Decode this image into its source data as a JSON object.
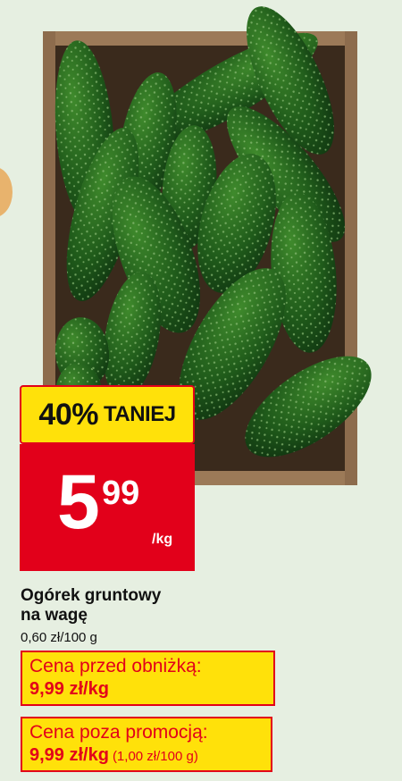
{
  "badge": {
    "percent": "40%",
    "text": "TANIEJ"
  },
  "price": {
    "integer": "5",
    "decimal": "99",
    "unit": "/kg"
  },
  "product": {
    "name_line1": "Ogórek gruntowy",
    "name_line2": "na wagę",
    "unit_price": "0,60 zł/100 g"
  },
  "promo_before": {
    "label": "Cena przed obniżką:",
    "value": "9,99 zł/kg"
  },
  "promo_outside": {
    "label": "Cena poza promocją:",
    "value": "9,99 zł/kg",
    "extra": "(1,00 zł/100 g)"
  },
  "colors": {
    "background": "#e6efe1",
    "brand_red": "#e2001a",
    "brand_yellow": "#ffe10a",
    "crate_wood": "#8a6a4d"
  },
  "image": "crate-of-cucumbers"
}
